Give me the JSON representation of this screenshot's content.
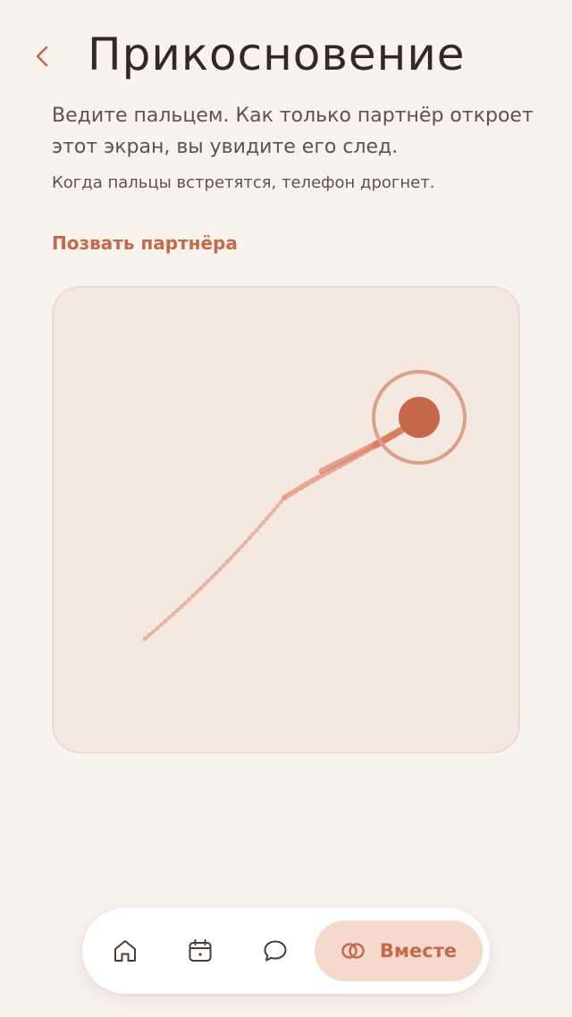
{
  "header": {
    "back_icon": "chevron-left-icon",
    "title": "Прикосновение"
  },
  "content": {
    "instructions": "Ведите пальцем. Как только партнёр откроет этот экран, вы увидите его след.",
    "hint": "Когда пальцы встретятся, телефон дрогнет.",
    "invite_link": "Позвать партнёра"
  },
  "touch_canvas": {
    "trail_color": "#e6a18a",
    "dot_color": "#c4674b",
    "ring_color": "#dc9f89"
  },
  "tab_bar": {
    "tabs": [
      {
        "id": "home",
        "icon": "home-icon",
        "label": ""
      },
      {
        "id": "calendar",
        "icon": "calendar-icon",
        "label": ""
      },
      {
        "id": "chat",
        "icon": "chat-bubble-icon",
        "label": ""
      },
      {
        "id": "together",
        "icon": "interlocked-rings-icon",
        "label": "Вместе",
        "active": true
      }
    ]
  },
  "colors": {
    "background": "#f9f3ee",
    "accent": "#c4694a",
    "canvas_bg": "#f4e8e0",
    "active_tab_bg": "#f4d9cd",
    "text_primary": "#352824",
    "text_secondary": "#5f524c"
  }
}
